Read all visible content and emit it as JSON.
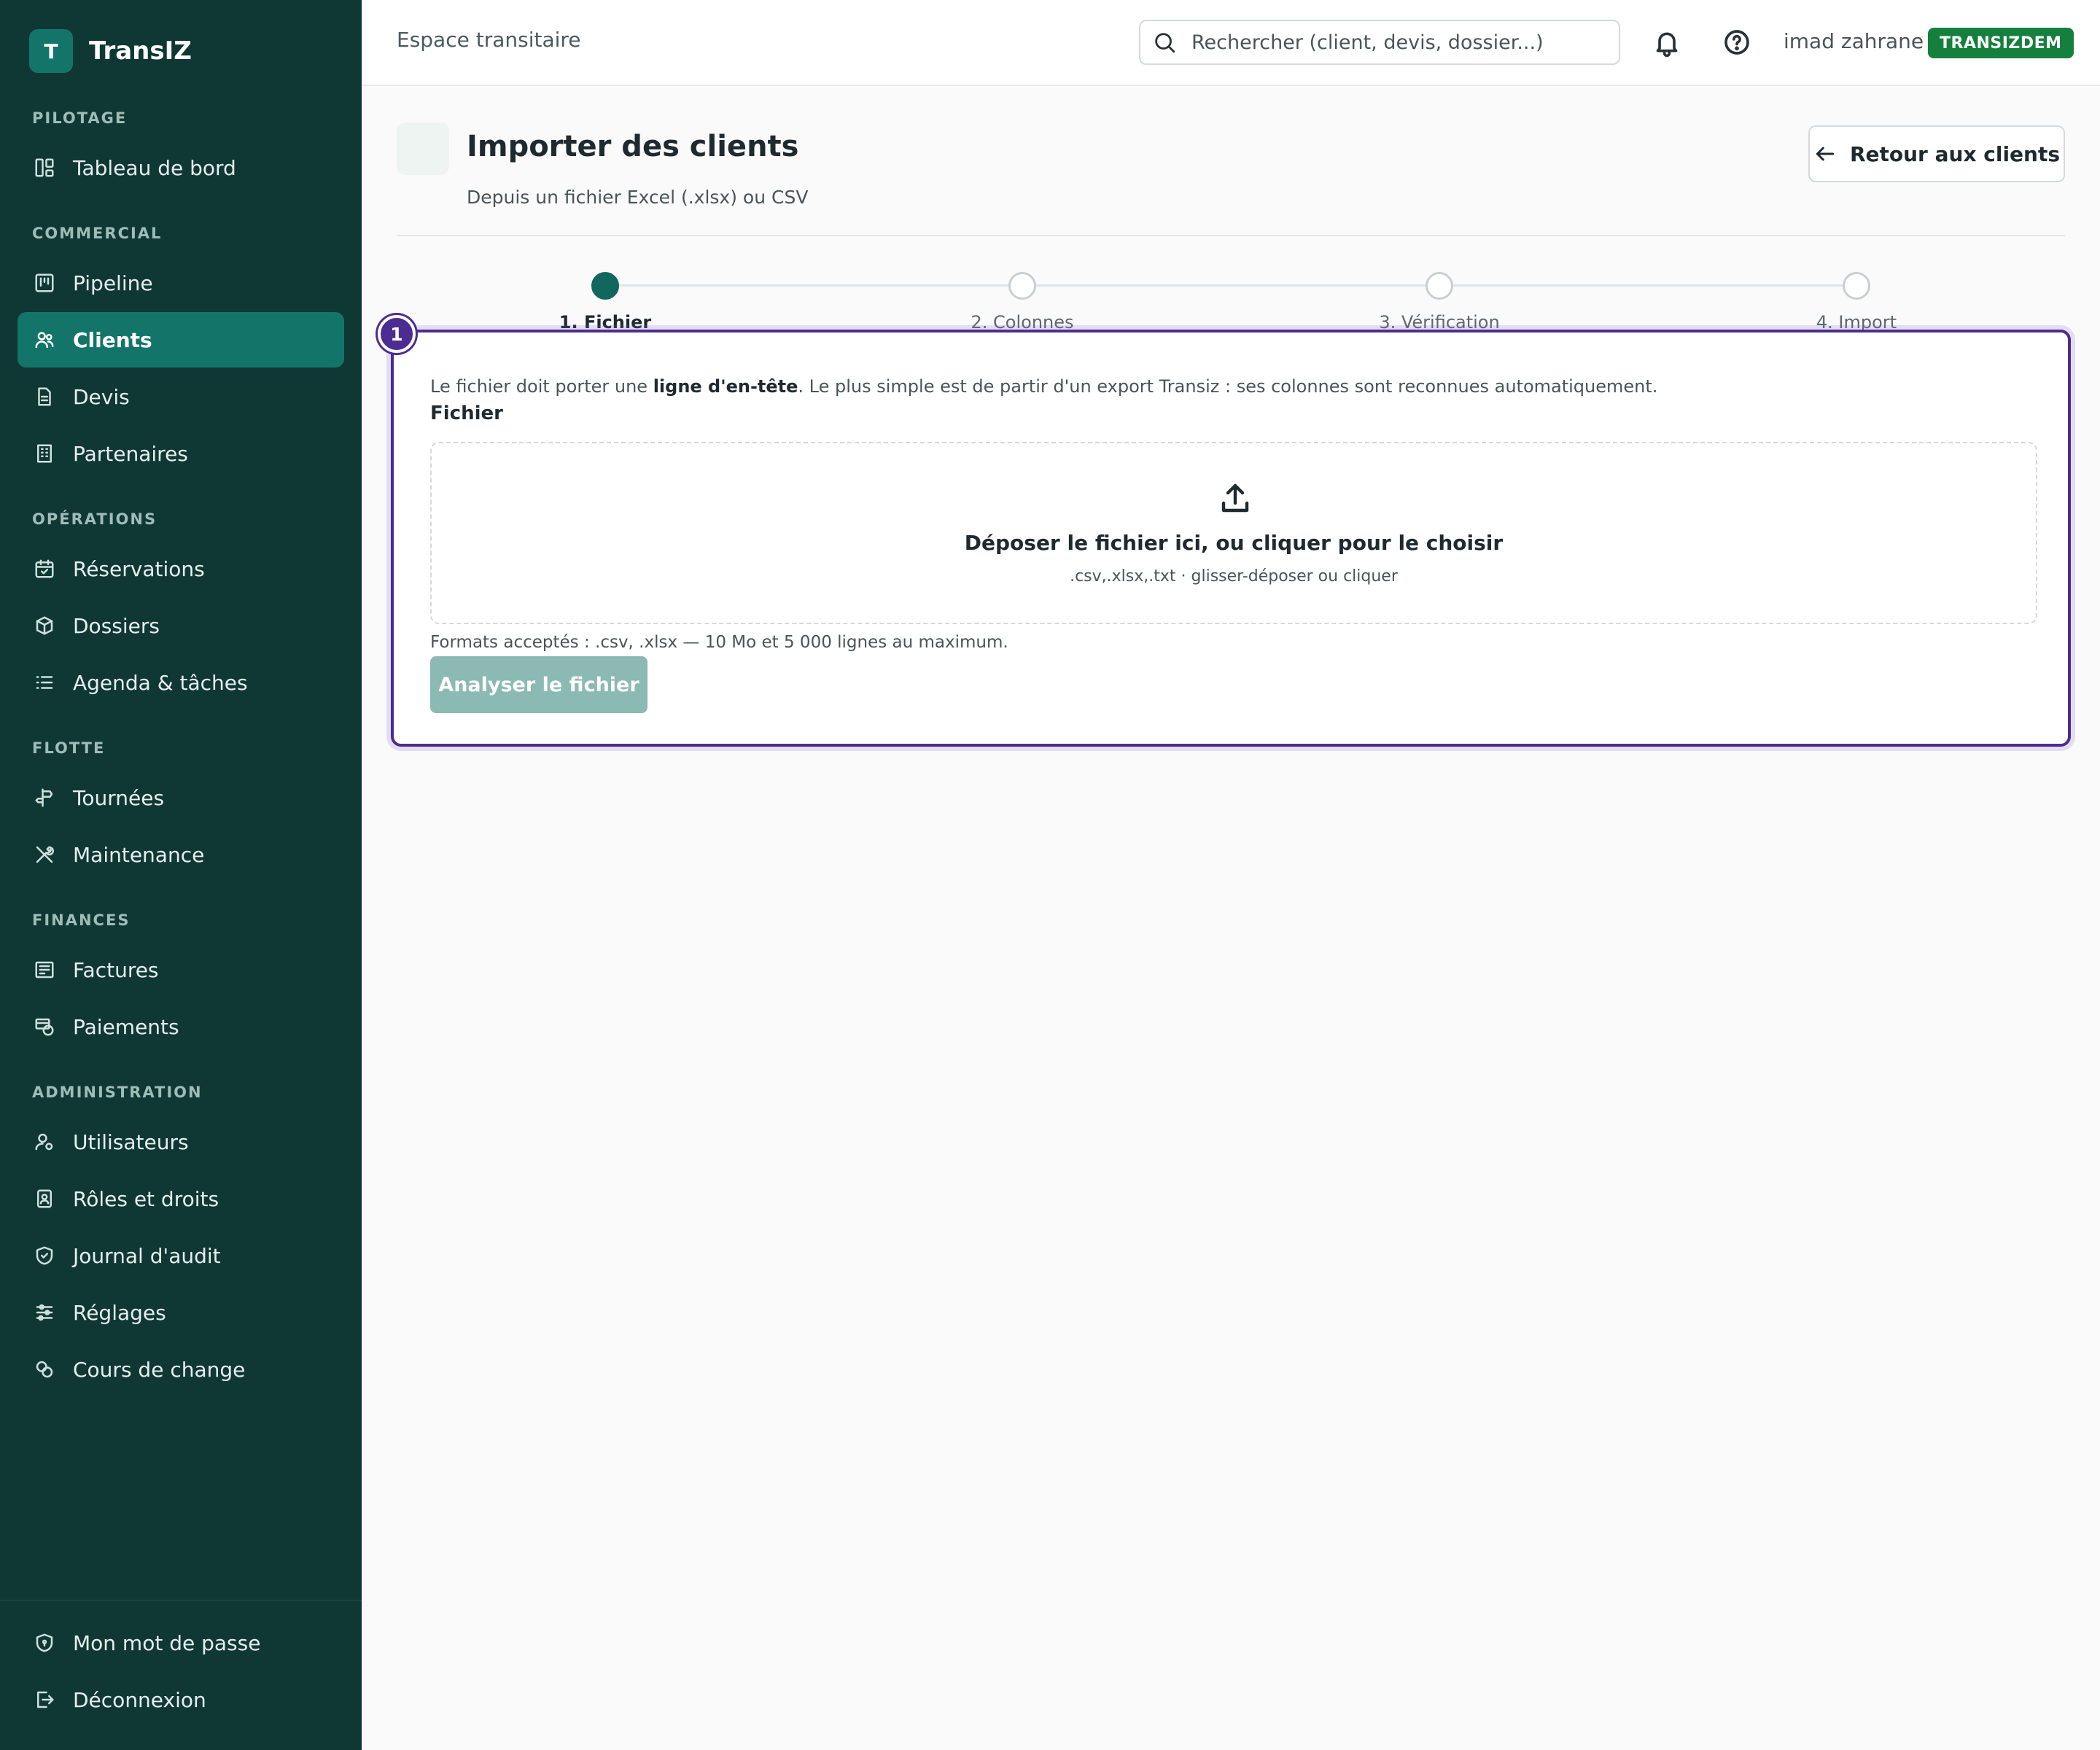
{
  "brand": {
    "logo_letter": "T",
    "name": "TransIZ"
  },
  "sidebar": {
    "sections": [
      {
        "title": "PILOTAGE",
        "items": [
          {
            "label": "Tableau de bord",
            "icon": "dashboard-icon"
          }
        ]
      },
      {
        "title": "COMMERCIAL",
        "items": [
          {
            "label": "Pipeline",
            "icon": "kanban-icon"
          },
          {
            "label": "Clients",
            "icon": "users-icon",
            "active": true
          },
          {
            "label": "Devis",
            "icon": "document-icon"
          },
          {
            "label": "Partenaires",
            "icon": "building-icon"
          }
        ]
      },
      {
        "title": "OPÉRATIONS",
        "items": [
          {
            "label": "Réservations",
            "icon": "calendar-check-icon"
          },
          {
            "label": "Dossiers",
            "icon": "box-icon"
          },
          {
            "label": "Agenda & tâches",
            "icon": "list-icon"
          }
        ]
      },
      {
        "title": "FLOTTE",
        "items": [
          {
            "label": "Tournées",
            "icon": "signpost-icon"
          },
          {
            "label": "Maintenance",
            "icon": "tools-icon"
          }
        ]
      },
      {
        "title": "FINANCES",
        "items": [
          {
            "label": "Factures",
            "icon": "invoice-icon"
          },
          {
            "label": "Paiements",
            "icon": "payment-icon"
          }
        ]
      },
      {
        "title": "ADMINISTRATION",
        "items": [
          {
            "label": "Utilisateurs",
            "icon": "user-gear-icon"
          },
          {
            "label": "Rôles et droits",
            "icon": "badge-icon"
          },
          {
            "label": "Journal d'audit",
            "icon": "shield-check-icon"
          },
          {
            "label": "Réglages",
            "icon": "sliders-icon"
          },
          {
            "label": "Cours de change",
            "icon": "coins-icon"
          }
        ]
      }
    ],
    "bottom": [
      {
        "label": "Mon mot de passe",
        "icon": "shield-lock-icon"
      },
      {
        "label": "Déconnexion",
        "icon": "logout-icon"
      }
    ]
  },
  "topbar": {
    "title": "Espace transitaire",
    "search_placeholder": "Rechercher (client, devis, dossier...)",
    "user_name": "imad zahrane",
    "tenant_badge": "TRANSIZDEM"
  },
  "page": {
    "title": "Importer des clients",
    "subtitle": "Depuis un fichier Excel (.xlsx) ou CSV",
    "back_label": "Retour aux clients"
  },
  "steps": [
    {
      "label": "1. Fichier",
      "active": true
    },
    {
      "label": "2. Colonnes",
      "active": false
    },
    {
      "label": "3. Vérification",
      "active": false
    },
    {
      "label": "4. Import",
      "active": false
    }
  ],
  "card": {
    "badge": "1",
    "intro_before": "Le fichier doit porter une ",
    "intro_bold": "ligne d'en-tête",
    "intro_after": ". Le plus simple est de partir d'un export Transiz : ses colonnes sont reconnues automatiquement.",
    "field_label": "Fichier",
    "drop_title": "Déposer le fichier ici, ou cliquer pour le choisir",
    "drop_hint": ".csv,.xlsx,.txt · glisser-déposer ou cliquer",
    "formats": "Formats acceptés : .csv, .xlsx — 10 Mo et 5 000 lignes au maximum.",
    "analyze_label": "Analyser le fichier"
  },
  "colors": {
    "sidebar_bg": "#0f3834",
    "accent": "#13756a",
    "highlight": "#4c2c92",
    "badge": "#15803d"
  }
}
